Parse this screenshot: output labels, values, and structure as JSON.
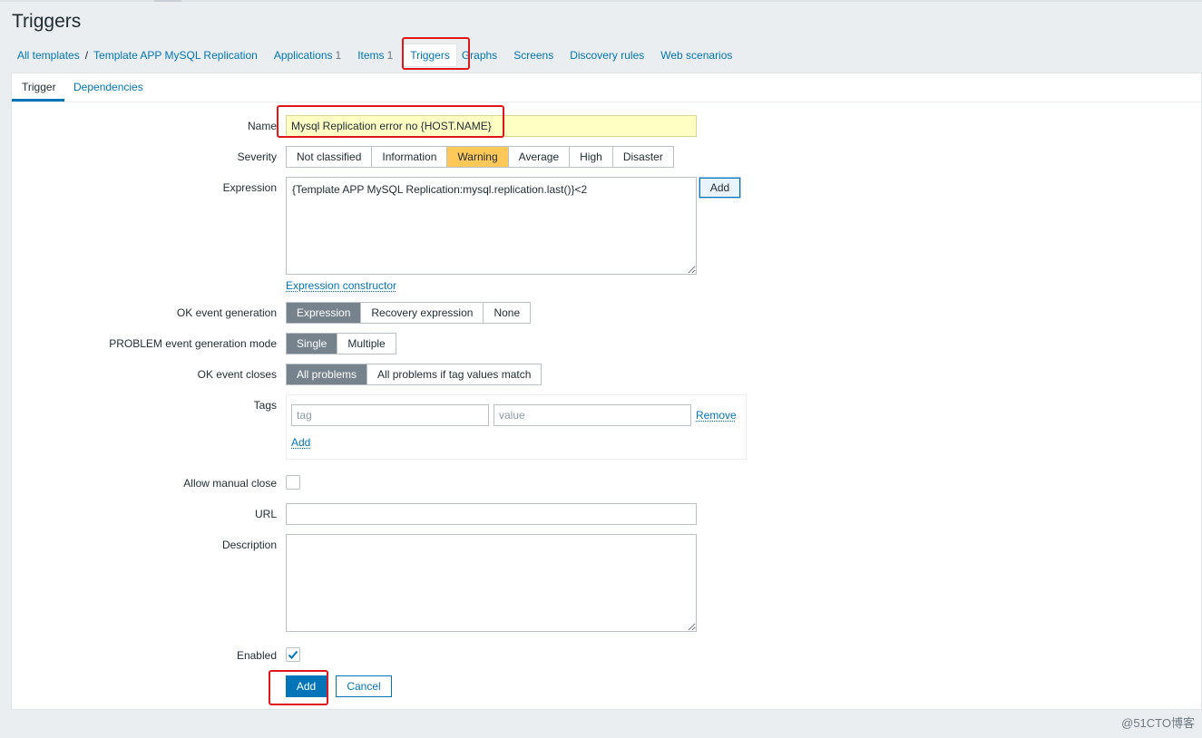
{
  "page": {
    "title": "Triggers"
  },
  "breadcrumb": {
    "all_templates": "All templates",
    "separator": "/",
    "template": "Template APP MySQL Replication",
    "applications": "Applications",
    "applications_count": "1",
    "items": "Items",
    "items_count": "1",
    "triggers": "Triggers",
    "graphs": "Graphs",
    "screens": "Screens",
    "discovery_rules": "Discovery rules",
    "web_scenarios": "Web scenarios"
  },
  "tabs": {
    "trigger": "Trigger",
    "dependencies": "Dependencies"
  },
  "form": {
    "name_label": "Name",
    "name_value": "Mysql Replication error no {HOST.NAME}",
    "severity_label": "Severity",
    "severity_options": [
      "Not classified",
      "Information",
      "Warning",
      "Average",
      "High",
      "Disaster"
    ],
    "severity_selected": "Warning",
    "expression_label": "Expression",
    "expression_value": "{Template APP MySQL Replication:mysql.replication.last()}<2",
    "expression_add": "Add",
    "expression_constructor": "Expression constructor",
    "ok_event_generation_label": "OK event generation",
    "ok_event_generation_options": [
      "Expression",
      "Recovery expression",
      "None"
    ],
    "problem_mode_label": "PROBLEM event generation mode",
    "problem_mode_options": [
      "Single",
      "Multiple"
    ],
    "ok_event_closes_label": "OK event closes",
    "ok_event_closes_options": [
      "All problems",
      "All problems if tag values match"
    ],
    "tags_label": "Tags",
    "tag_placeholder": "tag",
    "value_placeholder": "value",
    "tag_remove": "Remove",
    "tag_add": "Add",
    "allow_manual_close_label": "Allow manual close",
    "url_label": "URL",
    "description_label": "Description",
    "enabled_label": "Enabled",
    "add_button": "Add",
    "cancel_button": "Cancel"
  },
  "colors": {
    "accent": "#0275b8",
    "warning": "#ffc859",
    "selected": "#76838d",
    "highlight": "#e0161a"
  },
  "watermark": "@51CTO博客"
}
